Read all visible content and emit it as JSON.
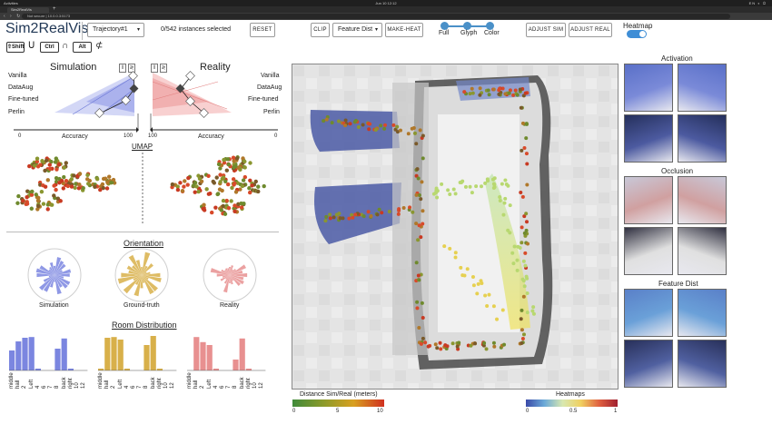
{
  "browser": {
    "window_title": "Sim2RealVis - Google Chrome",
    "tab_title": "Sim2RealVis",
    "address": "Not secure  |  10.0.0.3:5173",
    "os_left": "Activities",
    "os_right": "EN  ◐  ⏻",
    "clock": "Jun 10  12:12"
  },
  "toolbar": {
    "app_title": "Sim2RealVis",
    "trajectory_select": "Trajectory#1",
    "instances_selected": "0/542 instances selected",
    "reset_label": "RESET",
    "clip_label": "CLIP",
    "feature_select": "Feature Dist",
    "make_heat_label": "MAKE-HEAT",
    "slider_options": [
      "Full",
      "Glyph",
      "Color"
    ],
    "adjust_sim_label": "ADJUST SIM",
    "adjust_real_label": "ADJUST REAL",
    "heatmap_label": "Heatmap",
    "heatmap_on": true
  },
  "keys": {
    "shift": "⇧Shift",
    "cup": "Ս",
    "ctrl": "Ctrl",
    "cap": "∩",
    "alt": "Alt",
    "nsubset": "⊄"
  },
  "accuracy": {
    "sim_title": "Simulation",
    "real_title": "Reality",
    "models": [
      "Vanilla",
      "DataAug",
      "Fine-tuned",
      "Perlin"
    ],
    "axis_label": "Accuracy",
    "sim_axis": [
      "0",
      "100"
    ],
    "real_axis": [
      "100",
      "0"
    ]
  },
  "umap": {
    "title": "UMAP"
  },
  "orientation": {
    "title": "Orientation",
    "labels": [
      "Simulation",
      "Ground-truth",
      "Reality"
    ]
  },
  "rooms": {
    "title": "Room Distribution",
    "labels": [
      "middle",
      "hall",
      "2",
      "Left",
      "4",
      "6",
      "7",
      "8",
      "back",
      "right",
      "10",
      "12"
    ],
    "sim": [
      0.55,
      0.8,
      0.9,
      0.92,
      0.05,
      0.0,
      0.0,
      0.6,
      0.88,
      0.05,
      0.0,
      0.0
    ],
    "gt": [
      0.05,
      0.9,
      0.92,
      0.85,
      0.05,
      0.0,
      0.0,
      0.7,
      0.95,
      0.05,
      0.0,
      0.0
    ],
    "real": [
      0.0,
      0.92,
      0.78,
      0.7,
      0.05,
      0.0,
      0.0,
      0.3,
      0.88,
      0.05,
      0.0,
      0.0
    ]
  },
  "legends": {
    "distance_title": "Distance Sim/Real (meters)",
    "distance_ticks": [
      "0",
      "5",
      "10"
    ],
    "heatmap_title": "Heatmaps",
    "heatmap_ticks": [
      "0",
      "0.5",
      "1"
    ]
  },
  "right_panel": {
    "sections": [
      "Activation",
      "Occlusion",
      "Feature Dist"
    ]
  },
  "colors": {
    "sim": "#7b86e0",
    "gt": "#d8b04a",
    "real": "#e89090",
    "title": "#1f3654",
    "accent": "#3f8ed6"
  }
}
